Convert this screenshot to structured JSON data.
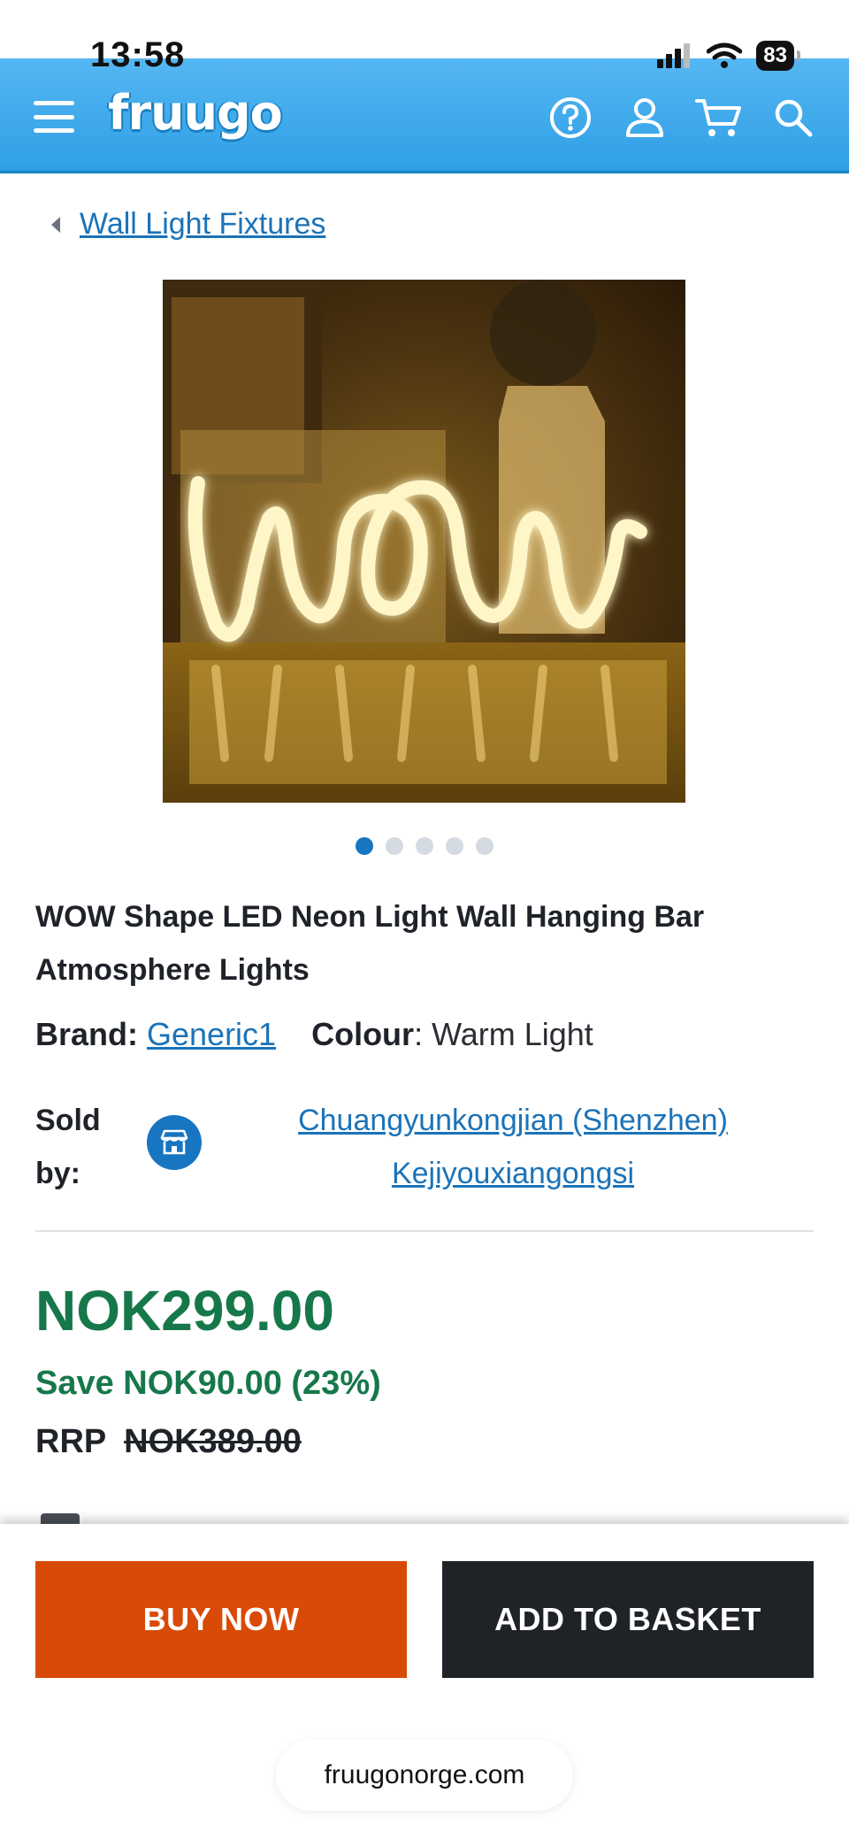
{
  "status_bar": {
    "time": "13:58",
    "battery": "83",
    "icons": [
      "signal-icon",
      "wifi-icon",
      "battery-icon"
    ]
  },
  "header": {
    "logo": "fruugo",
    "brand_color": "#2f9fe6",
    "icons": [
      "menu-icon",
      "help-icon",
      "account-icon",
      "cart-icon",
      "search-icon"
    ]
  },
  "breadcrumb": {
    "label": "Wall Light Fixtures"
  },
  "product": {
    "image_alt_icon": "neon-wow-sign-image",
    "carousel": {
      "total": 5,
      "active": 1
    },
    "title": "WOW Shape LED Neon Light Wall Hanging Bar Atmosphere Lights",
    "brand_label": "Brand:",
    "brand_value": "Generic1",
    "colour_label": "Colour",
    "colour_sep": ":",
    "colour_value": "Warm Light",
    "sold_by_label_1": "Sold",
    "sold_by_label_2": "by:",
    "seller_line_1": "Chuangyunkongjian (Shenzhen)",
    "seller_line_2": "Kejiyouxiangongsi"
  },
  "pricing": {
    "price": "NOK299.00",
    "save": "Save NOK90.00 (23%)",
    "rrp_label": "RRP",
    "rrp_value": "NOK389.00",
    "price_color": "#16784a"
  },
  "actions": {
    "buy_now": "BUY NOW",
    "add_to_basket": "ADD TO BASKET",
    "buy_color": "#d94a06",
    "basket_color": "#1f2328"
  },
  "browser": {
    "url": "fruugonorge.com"
  }
}
